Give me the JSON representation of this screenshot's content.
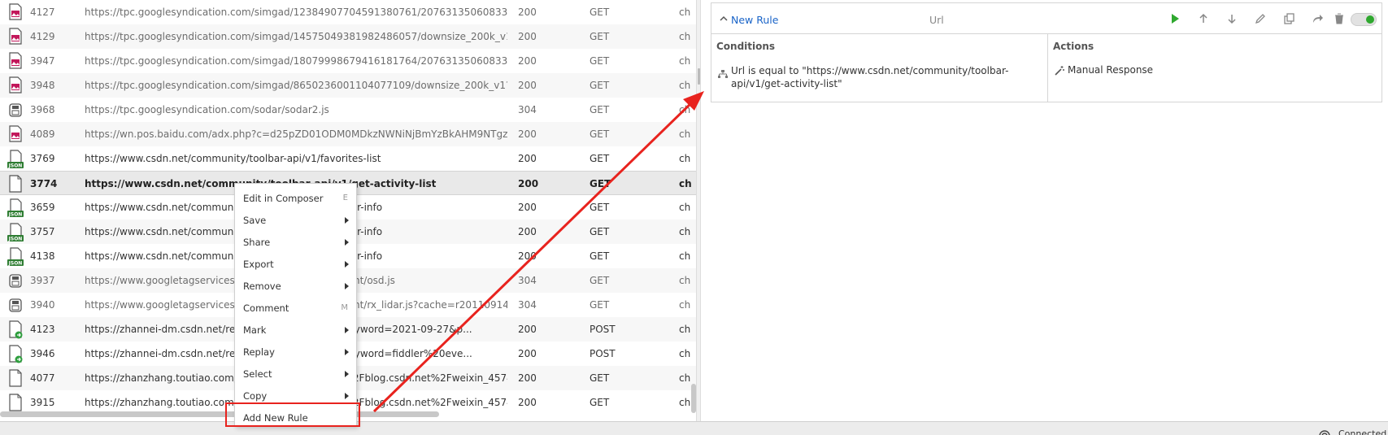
{
  "sessions": [
    {
      "id": "4127",
      "url": "https://tpc.googlesyndication.com/simgad/12384907704591380761/20763135060833236...",
      "status": "200",
      "method": "GET",
      "type": "ch",
      "icon": "image-icon",
      "dim": true
    },
    {
      "id": "4129",
      "url": "https://tpc.googlesyndication.com/simgad/14575049381982486057/downsize_200k_v1?w...",
      "status": "200",
      "method": "GET",
      "type": "ch",
      "icon": "image-icon",
      "dim": true
    },
    {
      "id": "3947",
      "url": "https://tpc.googlesyndication.com/simgad/18079998679416181764/20763135060833236...",
      "status": "200",
      "method": "GET",
      "type": "ch",
      "icon": "image-icon",
      "dim": true
    },
    {
      "id": "3948",
      "url": "https://tpc.googlesyndication.com/simgad/8650236001104077109/downsize_200k_v1?w=...",
      "status": "200",
      "method": "GET",
      "type": "ch",
      "icon": "image-icon",
      "dim": true
    },
    {
      "id": "3968",
      "url": "https://tpc.googlesyndication.com/sodar/sodar2.js",
      "status": "304",
      "method": "GET",
      "type": "ch",
      "icon": "cache-icon",
      "dim": true
    },
    {
      "id": "4089",
      "url": "https://wn.pos.baidu.com/adx.php?c=d25pZD01ODM0MDkzNWNiNjBmYzBkAHM9NTgzN...",
      "status": "200",
      "method": "GET",
      "type": "ch",
      "icon": "image-icon",
      "dim": true
    },
    {
      "id": "3769",
      "url": "https://www.csdn.net/community/toolbar-api/v1/favorites-list",
      "status": "200",
      "method": "GET",
      "type": "ch",
      "icon": "json-icon",
      "dim": false
    },
    {
      "id": "3774",
      "url": "https://www.csdn.net/community/toolbar-api/v1/get-activity-list",
      "status": "200",
      "method": "GET",
      "type": "ch",
      "icon": "document-icon",
      "dim": false,
      "selected": true
    },
    {
      "id": "3659",
      "url": "https://www.csdn.net/community/toolbar-api/v1/get-user-info",
      "status": "200",
      "method": "GET",
      "type": "ch",
      "icon": "json-icon",
      "dim": false
    },
    {
      "id": "3757",
      "url": "https://www.csdn.net/community/toolbar-api/v1/get-user-info",
      "status": "200",
      "method": "GET",
      "type": "ch",
      "icon": "json-icon",
      "dim": false
    },
    {
      "id": "4138",
      "url": "https://www.csdn.net/community/toolbar-api/v1/get-user-info",
      "status": "200",
      "method": "GET",
      "type": "ch",
      "icon": "json-icon",
      "dim": false
    },
    {
      "id": "3937",
      "url": "https://www.googletagservices.com/activeview/js/current/osd.js",
      "status": "304",
      "method": "GET",
      "type": "ch",
      "icon": "cache-icon",
      "dim": true
    },
    {
      "id": "3940",
      "url": "https://www.googletagservices.com/activeview/js/current/rx_lidar.js?cache=r20110914",
      "status": "304",
      "method": "GET",
      "type": "ch",
      "icon": "cache-icon",
      "dim": true
    },
    {
      "id": "4123",
      "url": "https://zhannei-dm.csdn.net/recommend/api/search?keyword=2021-09-27&p...",
      "status": "200",
      "method": "POST",
      "type": "ch",
      "icon": "post-icon",
      "dim": false
    },
    {
      "id": "3946",
      "url": "https://zhannei-dm.csdn.net/recommend/api/search?keyword=fiddler%20eve...",
      "status": "200",
      "method": "POST",
      "type": "ch",
      "icon": "post-icon",
      "dim": false
    },
    {
      "id": "4077",
      "url": "https://zhanzhang.toutiao.com/s.gif?r=https%3A%2F%2Fblog.csdn.net%2Fweixin_45740...",
      "status": "200",
      "method": "GET",
      "type": "ch",
      "icon": "document-icon",
      "dim": false
    },
    {
      "id": "3915",
      "url": "https://zhanzhang.toutiao.com/s.gif?r=https%3A%2F%2Fblog.csdn.net%2Fweixin_45740...",
      "status": "200",
      "method": "GET",
      "type": "ch",
      "icon": "document-icon",
      "dim": false
    }
  ],
  "context_menu": {
    "items": [
      {
        "label": "Edit in Composer",
        "shortcut": "E",
        "submenu": false
      },
      {
        "label": "Save",
        "shortcut": "",
        "submenu": true
      },
      {
        "label": "Share",
        "shortcut": "",
        "submenu": true
      },
      {
        "label": "Export",
        "shortcut": "",
        "submenu": true
      },
      {
        "label": "Remove",
        "shortcut": "",
        "submenu": true
      },
      {
        "label": "Comment",
        "shortcut": "M",
        "submenu": false
      },
      {
        "label": "Mark",
        "shortcut": "",
        "submenu": true
      },
      {
        "label": "Replay",
        "shortcut": "",
        "submenu": true
      },
      {
        "label": "Select",
        "shortcut": "",
        "submenu": true
      },
      {
        "label": "Copy",
        "shortcut": "",
        "submenu": true
      },
      {
        "label": "Add New Rule",
        "shortcut": "",
        "submenu": false,
        "highlighted": true
      }
    ]
  },
  "rule": {
    "name": "New Rule",
    "column": "Url",
    "conditions_title": "Conditions",
    "actions_title": "Actions",
    "condition_text": "Url is equal to \"https://www.csdn.net/community/toolbar-api/v1/get-activity-list\"",
    "action_text": "Manual Response",
    "enabled": true,
    "toolbar_icons": [
      "play-icon",
      "move-up-icon",
      "move-down-icon",
      "edit-icon",
      "duplicate-icon",
      "share-icon",
      "delete-icon"
    ]
  },
  "status_bar": {
    "text": "Connected"
  },
  "colors": {
    "accent": "#1a64c8",
    "play": "#2fa82f",
    "highlight": "#e8231e",
    "json_badge": "#2e7d32"
  }
}
